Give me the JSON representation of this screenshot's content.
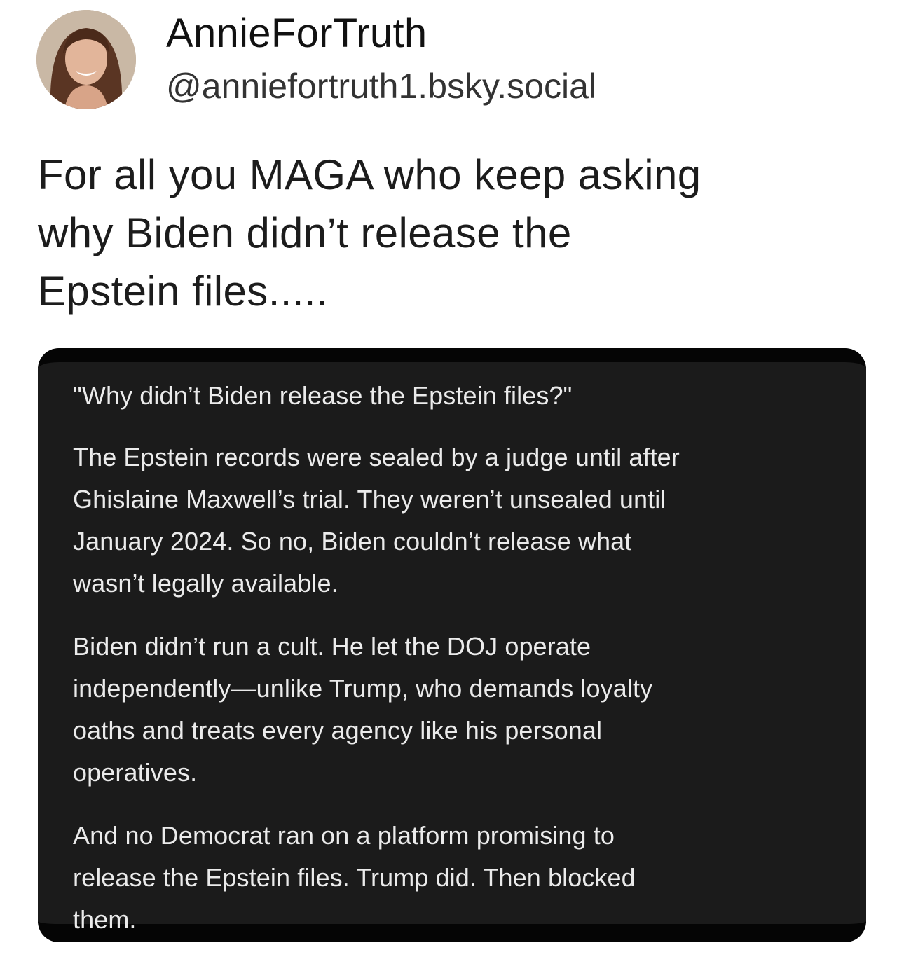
{
  "author": {
    "display_name": "AnnieForTruth",
    "handle": "@anniefortruth1.bsky.social",
    "avatar_icon": "profile-photo-icon"
  },
  "post": {
    "text_lines": [
      "For all you MAGA who keep asking",
      "why Biden didn’t release the",
      "Epstein files....."
    ]
  },
  "quoted_image": {
    "question": "\"Why didn’t Biden release the Epstein files?\"",
    "paragraphs": [
      {
        "lines": [
          "The Epstein records were sealed by a judge until after",
          "Ghislaine Maxwell’s trial. They weren’t unsealed until",
          "January 2024. So no, Biden couldn’t release what",
          "wasn’t legally available."
        ]
      },
      {
        "lines": [
          "Biden didn’t run a cult. He let the DOJ operate",
          "independently—unlike Trump, who demands loyalty",
          "oaths and treats every agency like his personal",
          "operatives."
        ]
      },
      {
        "lines": [
          "And no Democrat ran on a platform promising to",
          "release the Epstein files. Trump did. Then blocked",
          "them."
        ]
      }
    ]
  },
  "colors": {
    "card_background": "#1b1b1b",
    "card_text": "#ebebeb",
    "page_background": "#ffffff"
  }
}
